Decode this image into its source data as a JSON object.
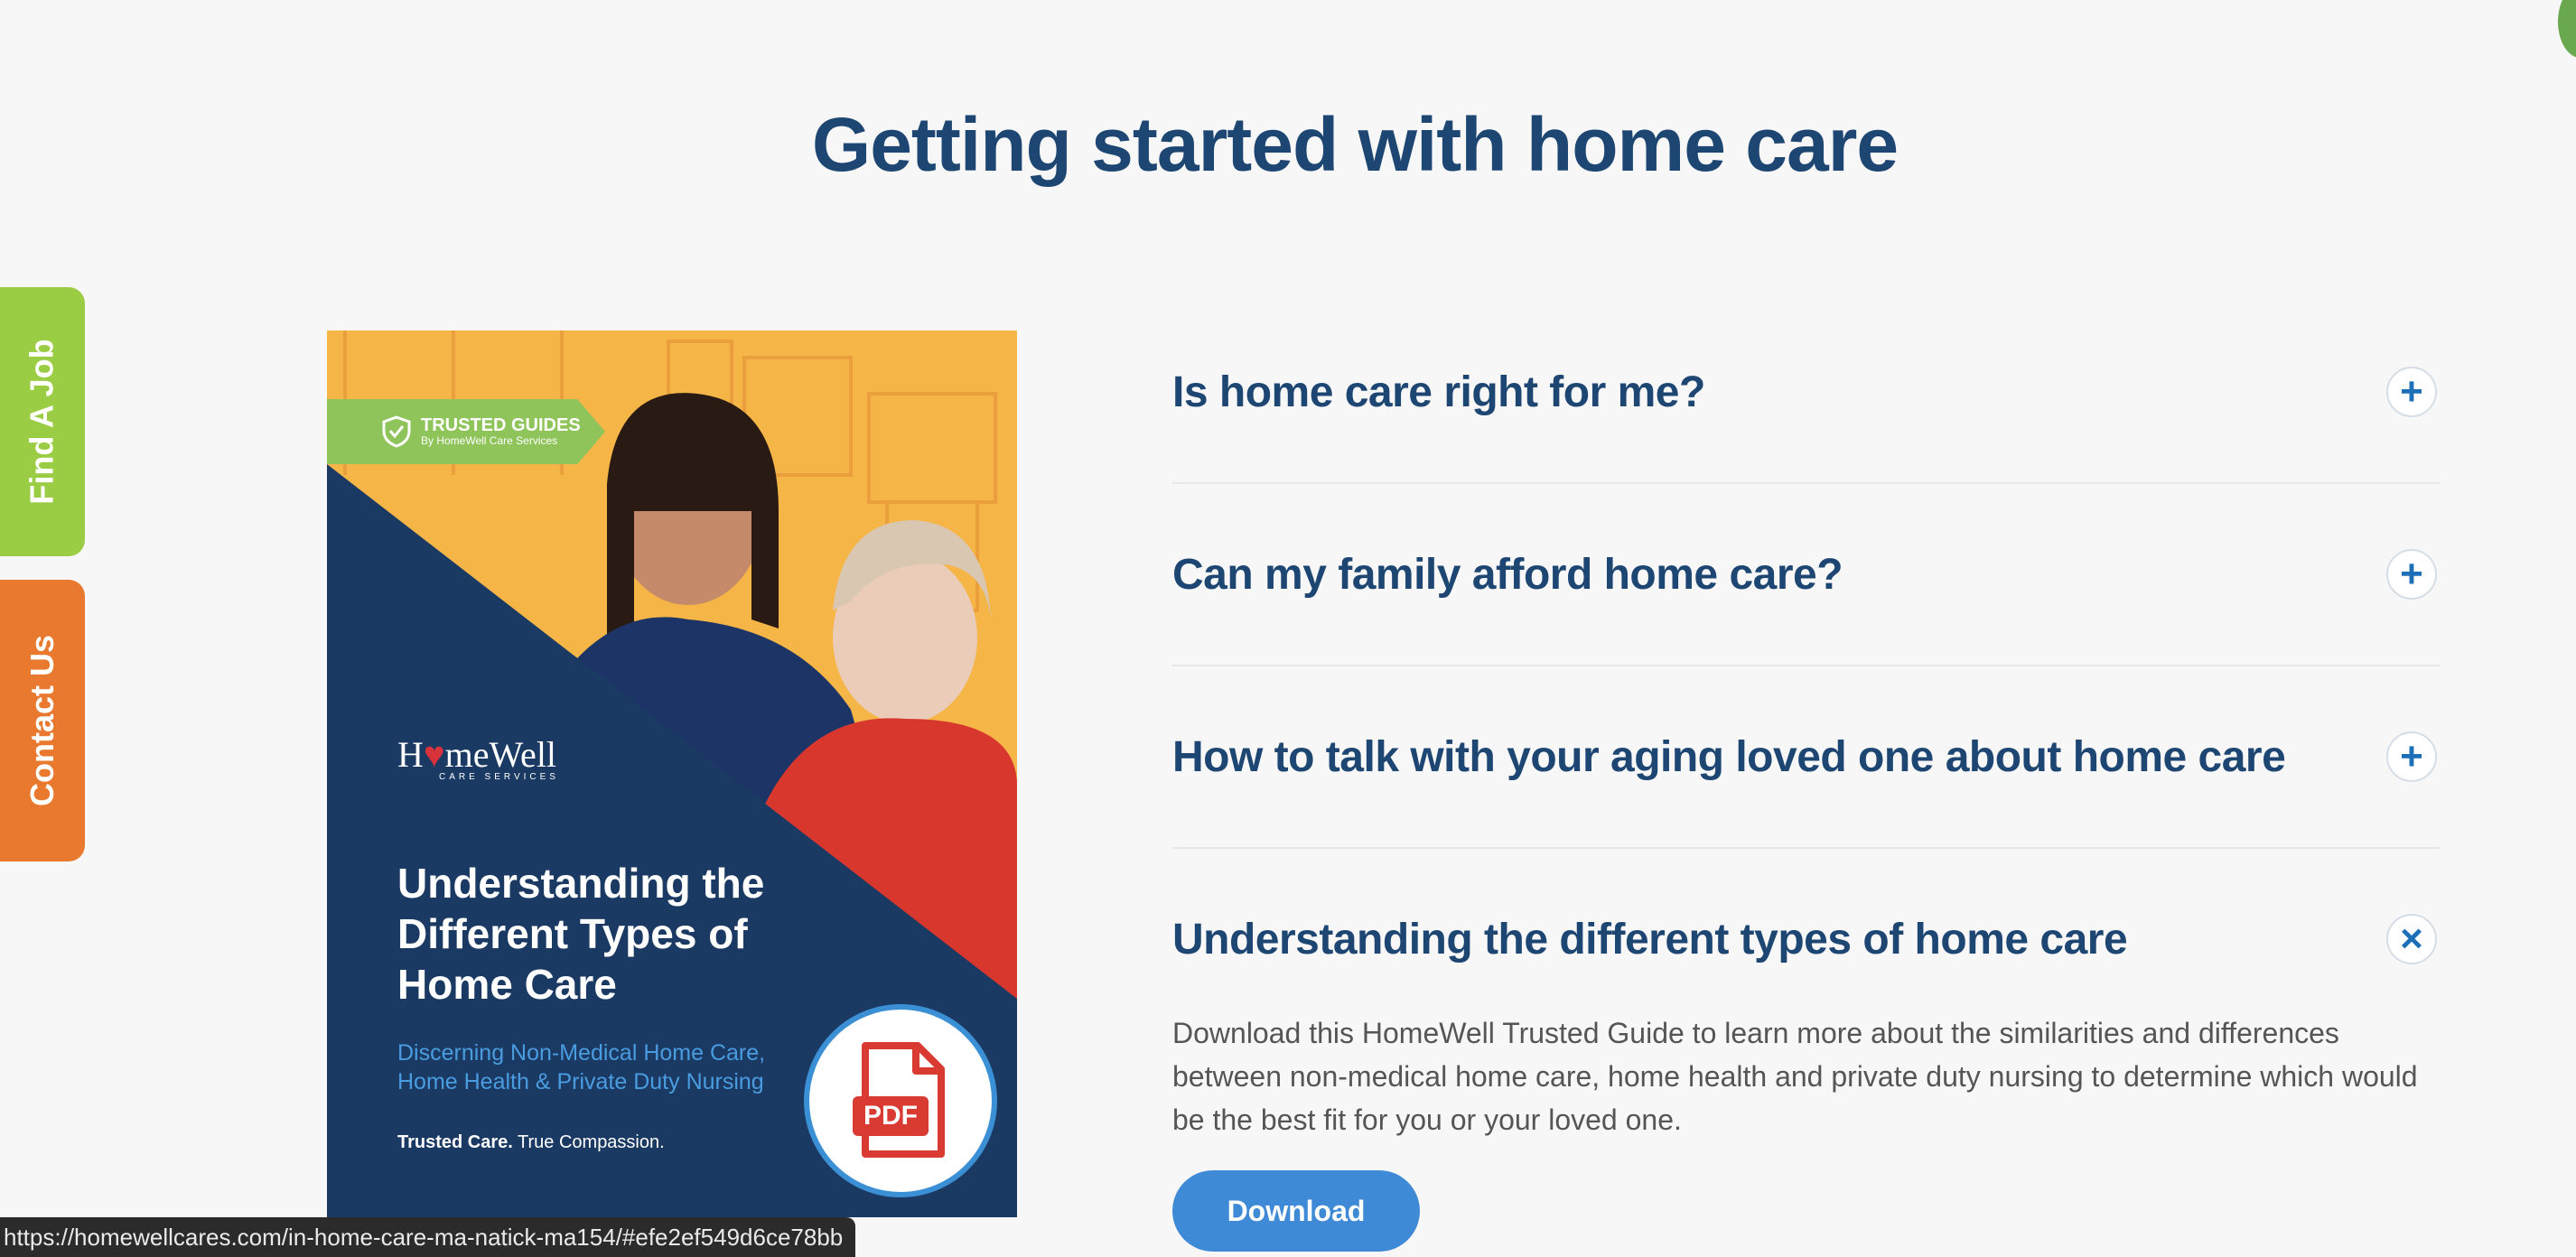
{
  "heading": "Getting started with home care",
  "side_tabs": {
    "find_job": "Find A Job",
    "contact_us": "Contact Us"
  },
  "guide": {
    "badge_title": "TRUSTED GUIDES",
    "badge_sub": "By HomeWell Care Services",
    "logo_main_pre": "H",
    "logo_heart": "♥",
    "logo_main_post": "meWell",
    "logo_tag": "CARE SERVICES",
    "title": "Understanding the Different Types of Home Care",
    "subtitle": "Discerning Non-Medical Home Care, Home Health & Private Duty Nursing",
    "tagline_bold": "Trusted Care.",
    "tagline_rest": " True Compassion.",
    "pdf_label": "PDF"
  },
  "faq": [
    {
      "question": "Is home care right for me?",
      "toggle": "+"
    },
    {
      "question": "Can my family afford home care?",
      "toggle": "+"
    },
    {
      "question": "How to talk with your aging loved one about home care",
      "toggle": "+"
    },
    {
      "question": "Understanding the different types of home care",
      "toggle": "×",
      "answer": "Download this HomeWell Trusted Guide to learn more about the similarities and differences between non-medical home care, home health and private duty nursing to determine which would be the best fit for you or your loved one.",
      "button": "Download"
    }
  ],
  "status_url": "https://homewellcares.com/in-home-care-ma-natick-ma154/#efe2ef549d6ce78bb",
  "colors": {
    "heading": "#1d4673",
    "find_job_tab": "#9acd43",
    "contact_tab": "#e8792e",
    "guide_navy": "#1b3a63",
    "guide_yellow": "#f5b547",
    "download_button": "#3f8ad6"
  }
}
